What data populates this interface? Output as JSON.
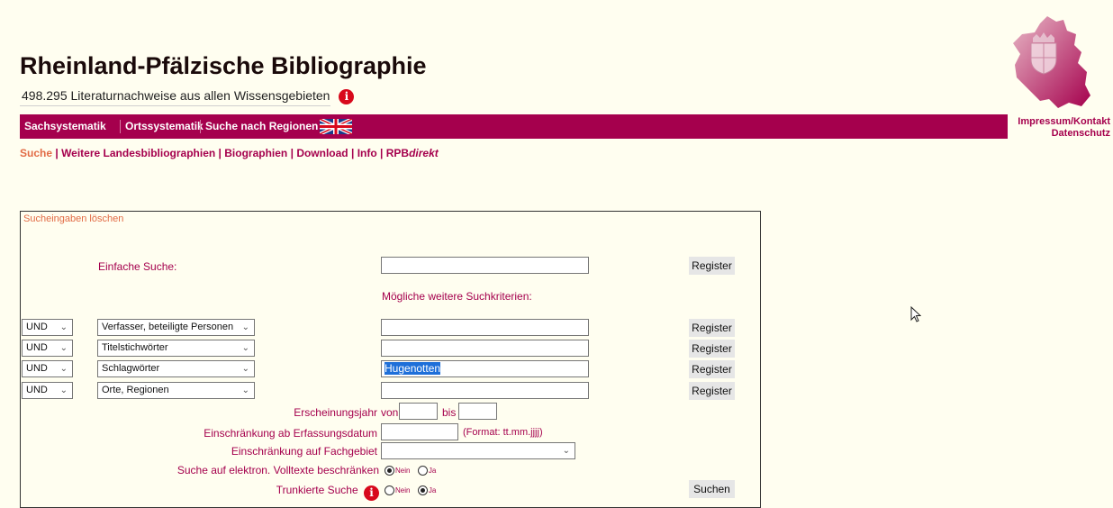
{
  "header": {
    "title": "Rheinland-Pfälzische Bibliographie",
    "subtitle": "498.295 Literaturnachweise aus allen Wissensgebieten",
    "info_icon": "i"
  },
  "nav": {
    "items": [
      "Sachsystematik",
      "Ortssystematik",
      "Suche nach Regionen"
    ],
    "flag_icon": "uk-flag-icon"
  },
  "side_links": [
    "Impressum/Kontakt",
    "Datenschutz"
  ],
  "links": {
    "items": [
      "Suche",
      "Weitere Landesbibliographien",
      "Biographien",
      "Download",
      "Info",
      "RPB"
    ],
    "suffix": "direkt",
    "separator": "|"
  },
  "form": {
    "clear_label": "Sucheingaben löschen",
    "simple_label": "Einfache Suche:",
    "simple_value": "",
    "register_label": "Register",
    "more_criteria_label": "Mögliche weitere Suchkriterien:",
    "rows": [
      {
        "op": "UND",
        "field": "Verfasser, beteiligte Personen",
        "value": ""
      },
      {
        "op": "UND",
        "field": "Titelstichwörter",
        "value": ""
      },
      {
        "op": "UND",
        "field": "Schlagwörter",
        "value": "Hugenotten"
      },
      {
        "op": "UND",
        "field": "Orte, Regionen",
        "value": ""
      }
    ],
    "year_label": "Erscheinungsjahr",
    "year_from": "von",
    "year_to": "bis",
    "date_label": "Einschränkung ab Erfassungsdatum",
    "date_format": "(Format: tt.mm.jjjj)",
    "subject_label": "Einschränkung auf Fachgebiet",
    "subject_value": "",
    "fulltext_label": "Suche auf elektron. Volltexte beschränken",
    "truncated_label": "Trunkierte Suche",
    "radio_no": "Nein",
    "radio_yes": "Ja",
    "fulltext_selected": "Nein",
    "truncated_selected": "Ja",
    "submit_label": "Suchen"
  },
  "colors": {
    "brand": "#a5004d",
    "accent": "#e26b45",
    "background": "#fffef0"
  }
}
